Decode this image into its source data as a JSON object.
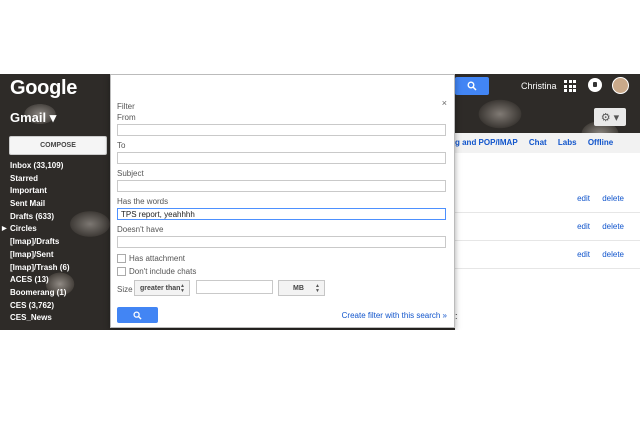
{
  "header": {
    "logo_text": "Google",
    "user_name": "Christina"
  },
  "nav": {
    "gmail_label": "Gmail ▾",
    "compose_label": "COMPOSE"
  },
  "sidebar": {
    "items": [
      {
        "label": "Inbox (33,109)"
      },
      {
        "label": "Starred"
      },
      {
        "label": "Important"
      },
      {
        "label": "Sent Mail"
      },
      {
        "label": "Drafts (633)"
      },
      {
        "label": "Circles"
      },
      {
        "label": "[Imap]/Drafts"
      },
      {
        "label": "[Imap]/Sent"
      },
      {
        "label": "[Imap]/Trash (6)"
      },
      {
        "label": "ACES (13)"
      },
      {
        "label": "Boomerang (1)"
      },
      {
        "label": "CES (3,762)"
      },
      {
        "label": "CES_News"
      }
    ]
  },
  "settings": {
    "tabs": [
      "g and POP/IMAP",
      "Chat",
      "Labs",
      "Offline"
    ],
    "rows": [
      {
        "edit": "edit",
        "delete": "delete"
      },
      {
        "edit": "edit",
        "delete": "delete"
      },
      {
        "edit": "edit",
        "delete": "delete"
      }
    ],
    "stray_colon": ":"
  },
  "filter_dialog": {
    "title": "Filter",
    "close": "×",
    "from_label": "From",
    "from_value": "",
    "to_label": "To",
    "to_value": "",
    "subject_label": "Subject",
    "subject_value": "",
    "has_words_label": "Has the words",
    "has_words_value": "TPS report, yeahhhh",
    "doesnt_have_label": "Doesn't have",
    "doesnt_have_value": "",
    "has_attachment_label": "Has attachment",
    "has_attachment_checked": false,
    "no_chats_label": "Don't include chats",
    "no_chats_checked": false,
    "size_label": "Size",
    "size_operator": "greater than",
    "size_value": "",
    "size_unit": "MB",
    "create_filter_link": "Create filter with this search »"
  },
  "colors": {
    "accent_blue": "#4285f4",
    "link_blue": "#1155cc"
  },
  "icons": {
    "search": "search-icon",
    "apps": "apps-grid-icon",
    "notifications": "notifications-icon",
    "settings": "gear-icon"
  }
}
